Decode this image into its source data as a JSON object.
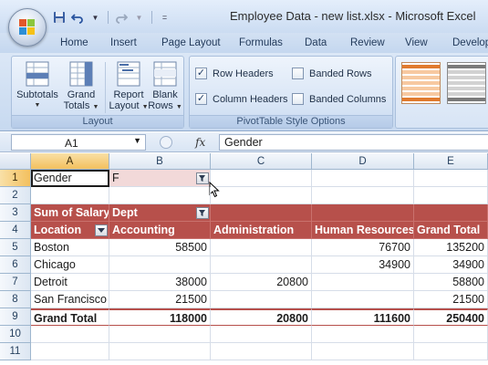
{
  "window": {
    "title": "Employee Data - new list.xlsx - Microsoft Excel"
  },
  "ribbon": {
    "tabs": [
      "Home",
      "Insert",
      "Page Layout",
      "Formulas",
      "Data",
      "Review",
      "View",
      "Develop"
    ],
    "layout_group": {
      "label": "Layout",
      "buttons": [
        {
          "label1": "Subtotals",
          "label2": ""
        },
        {
          "label1": "Grand",
          "label2": "Totals"
        },
        {
          "label1": "Report",
          "label2": "Layout"
        },
        {
          "label1": "Blank",
          "label2": "Rows"
        }
      ]
    },
    "style_options_group": {
      "label": "PivotTable Style Options",
      "options": [
        {
          "label": "Row Headers",
          "checked": true
        },
        {
          "label": "Column Headers",
          "checked": true
        },
        {
          "label": "Banded Rows",
          "checked": false
        },
        {
          "label": "Banded Columns",
          "checked": false
        }
      ]
    }
  },
  "formula_bar": {
    "name_box": "A1",
    "fx_label": "fx",
    "value": "Gender"
  },
  "sheet": {
    "columns": [
      "A",
      "B",
      "C",
      "D",
      "E"
    ],
    "selected_column": "A",
    "selected_row": "1",
    "rows": [
      "1",
      "2",
      "3",
      "4",
      "5",
      "6",
      "7",
      "8",
      "9",
      "10",
      "11"
    ],
    "cells": {
      "A1": "Gender",
      "B1": "F",
      "A3": "Sum of Salary",
      "B3": "Dept",
      "A4": "Location",
      "B4": "Accounting",
      "C4": "Administration",
      "D4": "Human Resources",
      "E4": "Grand Total",
      "A5": "Boston",
      "B5": "58500",
      "D5": "76700",
      "E5": "135200",
      "A6": "Chicago",
      "D6": "34900",
      "E6": "34900",
      "A7": "Detroit",
      "B7": "38000",
      "C7": "20800",
      "E7": "58800",
      "A8": "San Francisco",
      "B8": "21500",
      "E8": "21500",
      "A9": "Grand Total",
      "B9": "118000",
      "C9": "20800",
      "D9": "111600",
      "E9": "250400"
    }
  },
  "colors": {
    "pivot_header": "#b7504b",
    "page_field": "#f2d9d9",
    "selected_header": "#f3c05e"
  }
}
